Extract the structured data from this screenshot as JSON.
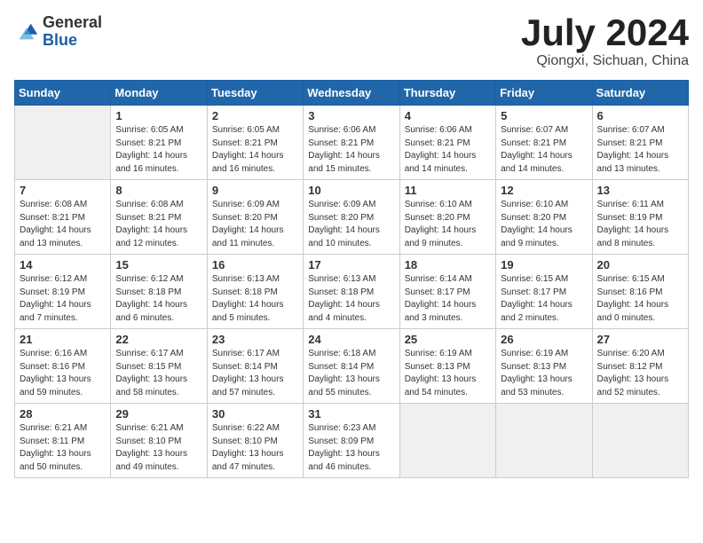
{
  "header": {
    "logo_general": "General",
    "logo_blue": "Blue",
    "month": "July 2024",
    "location": "Qiongxi, Sichuan, China"
  },
  "weekdays": [
    "Sunday",
    "Monday",
    "Tuesday",
    "Wednesday",
    "Thursday",
    "Friday",
    "Saturday"
  ],
  "weeks": [
    [
      {
        "day": "",
        "info": ""
      },
      {
        "day": "1",
        "info": "Sunrise: 6:05 AM\nSunset: 8:21 PM\nDaylight: 14 hours\nand 16 minutes."
      },
      {
        "day": "2",
        "info": "Sunrise: 6:05 AM\nSunset: 8:21 PM\nDaylight: 14 hours\nand 16 minutes."
      },
      {
        "day": "3",
        "info": "Sunrise: 6:06 AM\nSunset: 8:21 PM\nDaylight: 14 hours\nand 15 minutes."
      },
      {
        "day": "4",
        "info": "Sunrise: 6:06 AM\nSunset: 8:21 PM\nDaylight: 14 hours\nand 14 minutes."
      },
      {
        "day": "5",
        "info": "Sunrise: 6:07 AM\nSunset: 8:21 PM\nDaylight: 14 hours\nand 14 minutes."
      },
      {
        "day": "6",
        "info": "Sunrise: 6:07 AM\nSunset: 8:21 PM\nDaylight: 14 hours\nand 13 minutes."
      }
    ],
    [
      {
        "day": "7",
        "info": "Sunrise: 6:08 AM\nSunset: 8:21 PM\nDaylight: 14 hours\nand 13 minutes."
      },
      {
        "day": "8",
        "info": "Sunrise: 6:08 AM\nSunset: 8:21 PM\nDaylight: 14 hours\nand 12 minutes."
      },
      {
        "day": "9",
        "info": "Sunrise: 6:09 AM\nSunset: 8:20 PM\nDaylight: 14 hours\nand 11 minutes."
      },
      {
        "day": "10",
        "info": "Sunrise: 6:09 AM\nSunset: 8:20 PM\nDaylight: 14 hours\nand 10 minutes."
      },
      {
        "day": "11",
        "info": "Sunrise: 6:10 AM\nSunset: 8:20 PM\nDaylight: 14 hours\nand 9 minutes."
      },
      {
        "day": "12",
        "info": "Sunrise: 6:10 AM\nSunset: 8:20 PM\nDaylight: 14 hours\nand 9 minutes."
      },
      {
        "day": "13",
        "info": "Sunrise: 6:11 AM\nSunset: 8:19 PM\nDaylight: 14 hours\nand 8 minutes."
      }
    ],
    [
      {
        "day": "14",
        "info": "Sunrise: 6:12 AM\nSunset: 8:19 PM\nDaylight: 14 hours\nand 7 minutes."
      },
      {
        "day": "15",
        "info": "Sunrise: 6:12 AM\nSunset: 8:18 PM\nDaylight: 14 hours\nand 6 minutes."
      },
      {
        "day": "16",
        "info": "Sunrise: 6:13 AM\nSunset: 8:18 PM\nDaylight: 14 hours\nand 5 minutes."
      },
      {
        "day": "17",
        "info": "Sunrise: 6:13 AM\nSunset: 8:18 PM\nDaylight: 14 hours\nand 4 minutes."
      },
      {
        "day": "18",
        "info": "Sunrise: 6:14 AM\nSunset: 8:17 PM\nDaylight: 14 hours\nand 3 minutes."
      },
      {
        "day": "19",
        "info": "Sunrise: 6:15 AM\nSunset: 8:17 PM\nDaylight: 14 hours\nand 2 minutes."
      },
      {
        "day": "20",
        "info": "Sunrise: 6:15 AM\nSunset: 8:16 PM\nDaylight: 14 hours\nand 0 minutes."
      }
    ],
    [
      {
        "day": "21",
        "info": "Sunrise: 6:16 AM\nSunset: 8:16 PM\nDaylight: 13 hours\nand 59 minutes."
      },
      {
        "day": "22",
        "info": "Sunrise: 6:17 AM\nSunset: 8:15 PM\nDaylight: 13 hours\nand 58 minutes."
      },
      {
        "day": "23",
        "info": "Sunrise: 6:17 AM\nSunset: 8:14 PM\nDaylight: 13 hours\nand 57 minutes."
      },
      {
        "day": "24",
        "info": "Sunrise: 6:18 AM\nSunset: 8:14 PM\nDaylight: 13 hours\nand 55 minutes."
      },
      {
        "day": "25",
        "info": "Sunrise: 6:19 AM\nSunset: 8:13 PM\nDaylight: 13 hours\nand 54 minutes."
      },
      {
        "day": "26",
        "info": "Sunrise: 6:19 AM\nSunset: 8:13 PM\nDaylight: 13 hours\nand 53 minutes."
      },
      {
        "day": "27",
        "info": "Sunrise: 6:20 AM\nSunset: 8:12 PM\nDaylight: 13 hours\nand 52 minutes."
      }
    ],
    [
      {
        "day": "28",
        "info": "Sunrise: 6:21 AM\nSunset: 8:11 PM\nDaylight: 13 hours\nand 50 minutes."
      },
      {
        "day": "29",
        "info": "Sunrise: 6:21 AM\nSunset: 8:10 PM\nDaylight: 13 hours\nand 49 minutes."
      },
      {
        "day": "30",
        "info": "Sunrise: 6:22 AM\nSunset: 8:10 PM\nDaylight: 13 hours\nand 47 minutes."
      },
      {
        "day": "31",
        "info": "Sunrise: 6:23 AM\nSunset: 8:09 PM\nDaylight: 13 hours\nand 46 minutes."
      },
      {
        "day": "",
        "info": ""
      },
      {
        "day": "",
        "info": ""
      },
      {
        "day": "",
        "info": ""
      }
    ]
  ]
}
